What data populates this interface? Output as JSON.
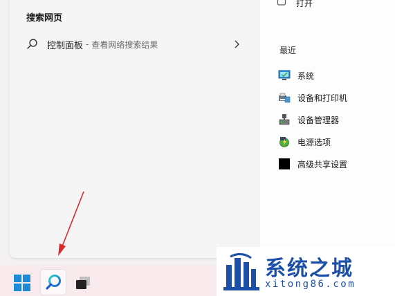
{
  "start_menu": {
    "search_section_title": "搜索网页",
    "web_result": {
      "query": "控制面板",
      "separator": "-",
      "hint": "查看网络搜索结果"
    }
  },
  "right_panel": {
    "top_action": "打开",
    "recent_title": "最近",
    "recent_items": [
      {
        "label": "系统",
        "icon": "system-icon"
      },
      {
        "label": "设备和打印机",
        "icon": "devices-printers-icon"
      },
      {
        "label": "设备管理器",
        "icon": "device-manager-icon"
      },
      {
        "label": "电源选项",
        "icon": "power-options-icon"
      },
      {
        "label": "高级共享设置",
        "icon": "advanced-sharing-icon"
      }
    ]
  },
  "taskbar": {
    "buttons": [
      {
        "name": "start",
        "icon": "windows-logo-icon"
      },
      {
        "name": "search",
        "icon": "search-icon",
        "active": true
      },
      {
        "name": "task-view",
        "icon": "task-view-icon"
      }
    ]
  },
  "watermark": {
    "title": "系统之城",
    "url": "xitong86.com"
  },
  "colors": {
    "accent": "#1c4fa8",
    "arrow": "#d62a2a"
  }
}
